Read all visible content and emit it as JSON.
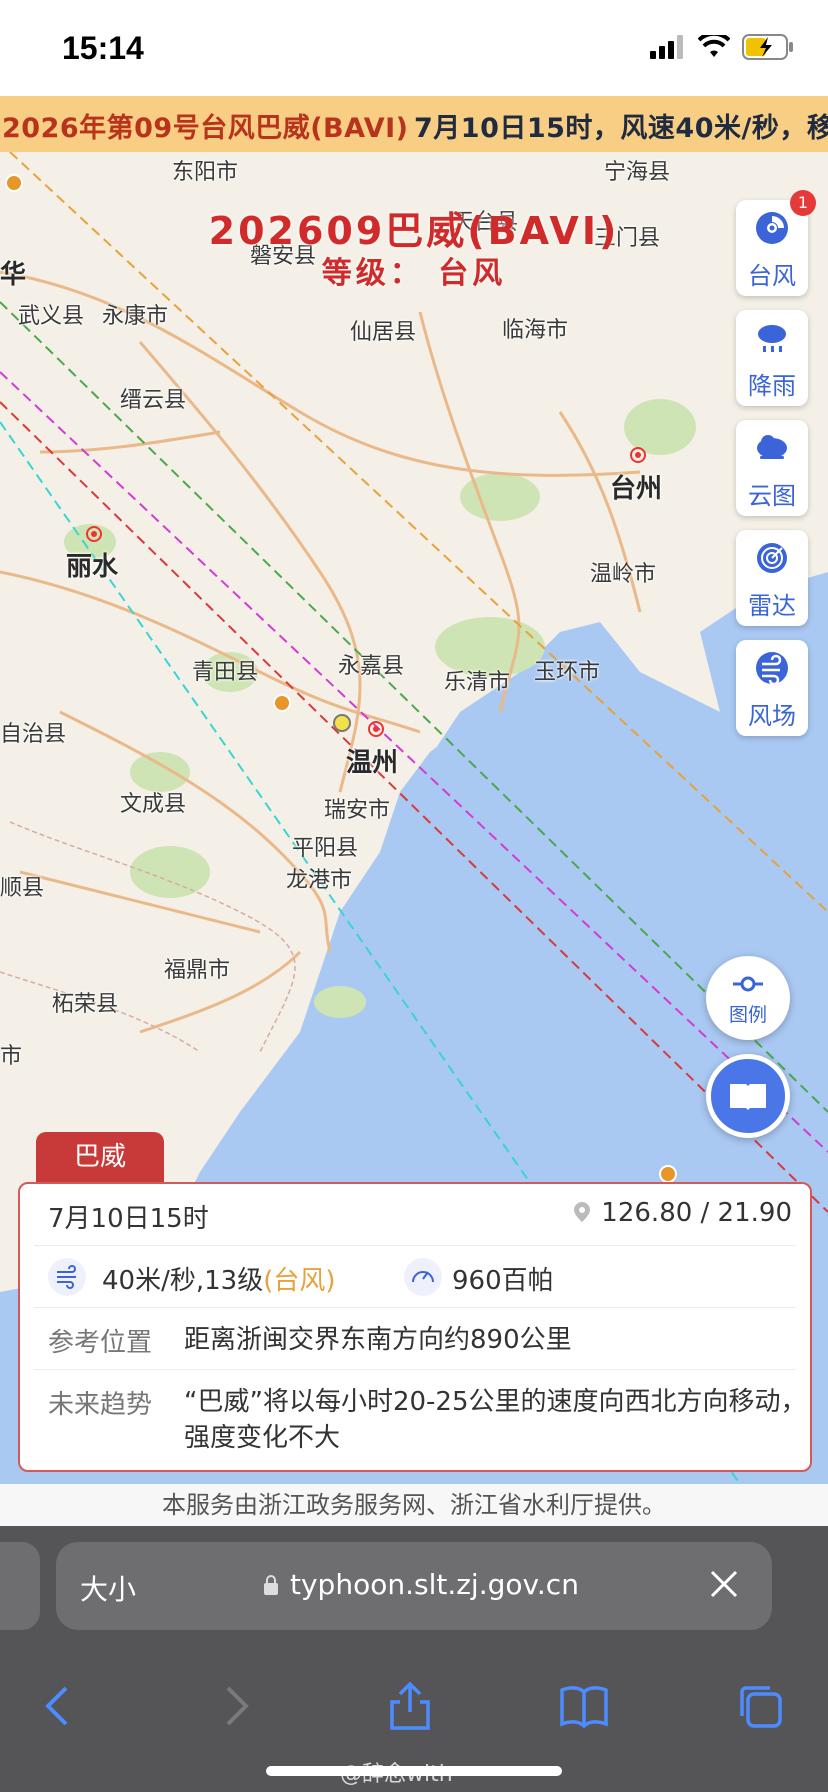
{
  "status": {
    "time": "15:14"
  },
  "ticker": {
    "left": "2026年第09号台风巴威(BAVI)",
    "right": "7月10日15时，风速40米/秒，移"
  },
  "storm": {
    "title": "202609巴威(BAVI)",
    "level": "等级：  台风"
  },
  "places": {
    "dongyang": "东阳市",
    "ninghai": "宁海县",
    "tiantai": "天台县",
    "sanmen": "三门县",
    "panan": "磐安县",
    "hua": "华",
    "wuyi": "武义县",
    "yongkang": "永康市",
    "xianju": "仙居县",
    "linhai": "临海市",
    "jinyun": "缙云县",
    "taizhou": "台州",
    "lishui": "丽水",
    "wenling": "温岭市",
    "qingtian": "青田县",
    "yongjia": "永嘉县",
    "yueqing": "乐清市",
    "yuhuan": "玉环市",
    "zizhi": "自治县",
    "wenzhou": "温州",
    "wencheng": "文成县",
    "ruian": "瑞安市",
    "pingyang": "平阳县",
    "longgang": "龙港市",
    "shunxian": "顺县",
    "fuding": "福鼎市",
    "zherong": "柘荣县",
    "shi": "市"
  },
  "tools": [
    {
      "label": "台风",
      "icon": "typhoon-icon",
      "badge": "1"
    },
    {
      "label": "降雨",
      "icon": "rain-icon"
    },
    {
      "label": "云图",
      "icon": "cloud-icon"
    },
    {
      "label": "雷达",
      "icon": "radar-icon"
    },
    {
      "label": "风场",
      "icon": "wind-field-icon"
    }
  ],
  "legend": {
    "label": "图例"
  },
  "card": {
    "tab": "巴威",
    "datetime": "7月10日15时",
    "coord": "126.80 / 21.90",
    "wind": "40米/秒,13级",
    "wind_level": "(台风)",
    "pressure": "960百帕",
    "ref_key": "参考位置",
    "ref_val": "距离浙闽交界东南方向约890公里",
    "trend_key": "未来趋势",
    "trend_val": "“巴威”将以每小时20-25公里的速度向西北方向移动，强度变化不大"
  },
  "footer": "本服务由浙江政务服务网、浙江省水利厅提供。",
  "browser": {
    "size_label": "大小",
    "url": "typhoon.slt.zj.gov.cn"
  },
  "watermark": "@辞念with",
  "colors": {
    "accent": "#3a64d8",
    "storm_red": "#d02a2a",
    "ticker_bg": "#f8cd84"
  }
}
